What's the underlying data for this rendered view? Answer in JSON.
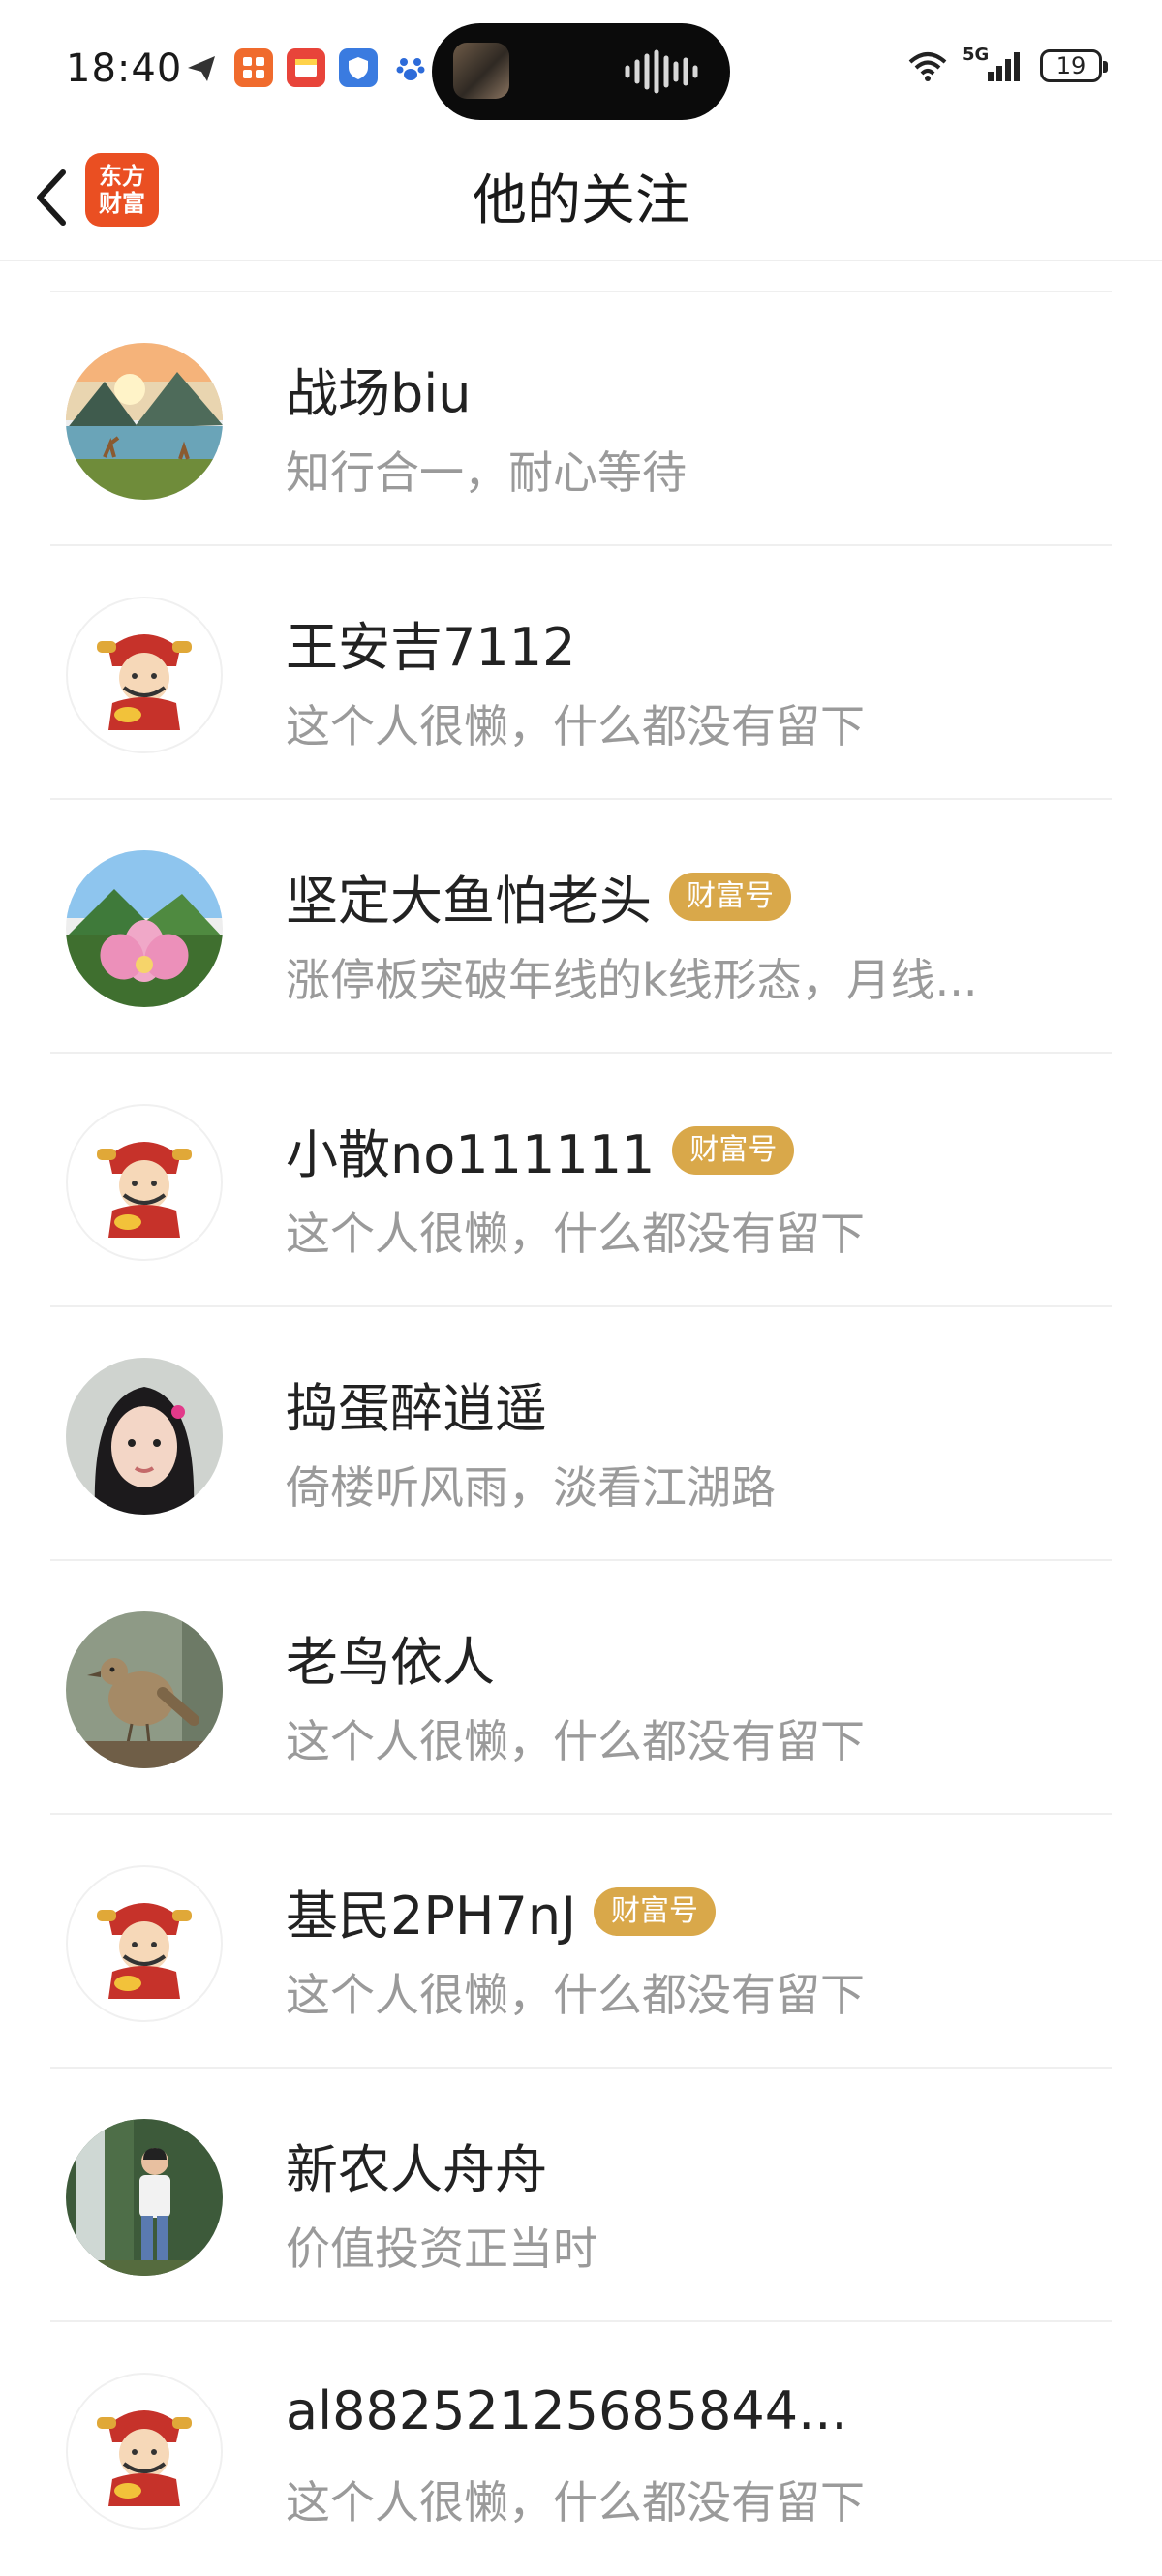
{
  "status_bar": {
    "time": "18:40",
    "network": "5G",
    "battery": "19",
    "left_icons": [
      "send-app-icon",
      "grid-app-icon",
      "calendar-app-icon",
      "shield-app-icon",
      "paw-app-icon"
    ],
    "right_icons": [
      "wifi-icon",
      "signal-icon",
      "battery-icon"
    ]
  },
  "nav": {
    "title": "他的关注",
    "logo_line1": "东方",
    "logo_line2": "财富"
  },
  "colors": {
    "badge": "#d9a84a",
    "logo": "#ea4f22",
    "bio_text": "#9a9a9a",
    "divider": "#efefef"
  },
  "follows": [
    {
      "name": "战场biu",
      "bio": "知行合一，耐心等待",
      "badge": "",
      "avatar": "landscape-deer"
    },
    {
      "name": "王安吉7112",
      "bio": "这个人很懒，什么都没有留下",
      "badge": "",
      "avatar": "default-caishen"
    },
    {
      "name": "坚定大鱼怕老头",
      "bio": "涨停板突破年线的k线形态，月线...",
      "badge": "财富号",
      "avatar": "lotus"
    },
    {
      "name": "小散no111111",
      "bio": "这个人很懒，什么都没有留下",
      "badge": "财富号",
      "avatar": "default-caishen"
    },
    {
      "name": "捣蛋醉逍遥",
      "bio": "倚楼听风雨，淡看江湖路",
      "badge": "",
      "avatar": "girl-portrait"
    },
    {
      "name": "老鸟依人",
      "bio": "这个人很懒，什么都没有留下",
      "badge": "",
      "avatar": "bird"
    },
    {
      "name": "基民2PH7nJ",
      "bio": "这个人很懒，什么都没有留下",
      "badge": "财富号",
      "avatar": "default-caishen"
    },
    {
      "name": "新农人舟舟",
      "bio": "价值投资正当时",
      "badge": "",
      "avatar": "man-waterfall"
    },
    {
      "name": "al88252125685844...",
      "bio": "这个人很懒，什么都没有留下",
      "badge": "",
      "avatar": "default-caishen"
    }
  ]
}
